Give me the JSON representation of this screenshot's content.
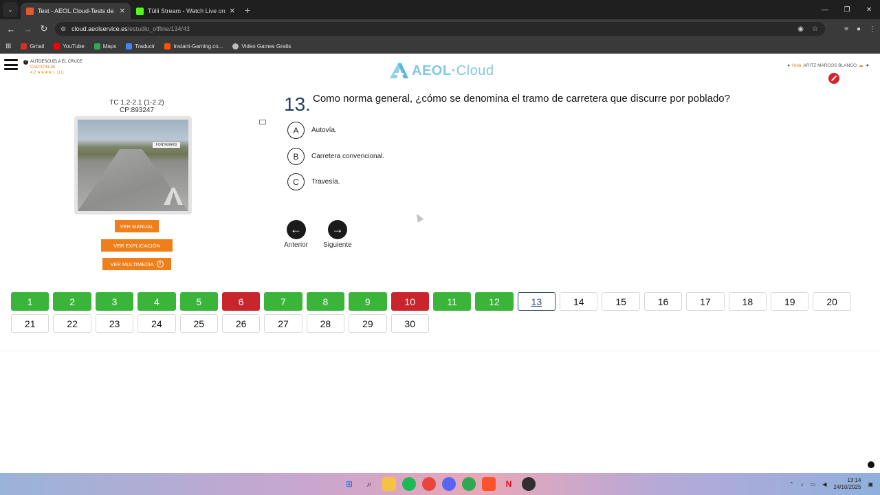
{
  "browser": {
    "tabs": [
      {
        "title": "Test - AEOL.Cloud-Tests de Aut",
        "favicon": "aeol-favicon",
        "active": true
      },
      {
        "title": "Tülli Stream - Watch Live on Kic",
        "favicon": "kick-favicon",
        "active": false
      }
    ],
    "url_host": "cloud.aeolservice.es",
    "url_path": "/estudio_offline/134/43",
    "bookmarks": [
      {
        "label": "Gmail",
        "icon": "gmail-icon",
        "color": "#d93025"
      },
      {
        "label": "YouTube",
        "icon": "youtube-icon",
        "color": "#ff0000"
      },
      {
        "label": "Maps",
        "icon": "maps-icon",
        "color": "#34a853"
      },
      {
        "label": "Traducir",
        "icon": "translate-icon",
        "color": "#4285f4"
      },
      {
        "label": "Instant-Gaming.co...",
        "icon": "instant-gaming-icon",
        "color": "#ff5400"
      },
      {
        "label": "Video Games Gratis",
        "icon": "globe-icon",
        "color": "#bbbbbb"
      }
    ]
  },
  "header": {
    "school_name": "AUTOESCUELA EL CRUCE",
    "school_code": "CAD:3741-35",
    "school_rating": "4.2 ★★★★☆ (11)",
    "logo_text": "AEOL",
    "logo_cloud": "Cloud",
    "greeting": "Hola",
    "user_name": "ARITZ MARCOS BLANCO",
    "brand_color": "#7fc8e6",
    "accent_color": "#ef7f1a"
  },
  "question": {
    "ref_line1": "TC 1.2-2.1 (1-2.2)",
    "ref_line2": "CP:893247",
    "photo_sign": "FONTANARS",
    "number": "13.",
    "text": "Como norma general, ¿cómo se denomina el tramo de carretera que discurre por poblado?",
    "answers": [
      {
        "letter": "A",
        "text": "Autovía."
      },
      {
        "letter": "B",
        "text": "Carretera convencional."
      },
      {
        "letter": "C",
        "text": "Travesía."
      }
    ],
    "buttons": {
      "manual": "VER MANUAL",
      "explanation": "VER EXPLICACIÓN",
      "multimedia": "VER MULTIMEDIA",
      "multimedia_count": "0"
    },
    "nav": {
      "prev": "Anterior",
      "next": "Siguiente"
    }
  },
  "grid": {
    "items": [
      {
        "n": "1",
        "state": "ok"
      },
      {
        "n": "2",
        "state": "ok"
      },
      {
        "n": "3",
        "state": "ok"
      },
      {
        "n": "4",
        "state": "ok"
      },
      {
        "n": "5",
        "state": "ok"
      },
      {
        "n": "6",
        "state": "fail"
      },
      {
        "n": "7",
        "state": "ok"
      },
      {
        "n": "8",
        "state": "ok"
      },
      {
        "n": "9",
        "state": "ok"
      },
      {
        "n": "10",
        "state": "fail"
      },
      {
        "n": "11",
        "state": "ok"
      },
      {
        "n": "12",
        "state": "ok"
      },
      {
        "n": "13",
        "state": "current"
      },
      {
        "n": "14",
        "state": "pending"
      },
      {
        "n": "15",
        "state": "pending"
      },
      {
        "n": "16",
        "state": "pending"
      },
      {
        "n": "17",
        "state": "pending"
      },
      {
        "n": "18",
        "state": "pending"
      },
      {
        "n": "19",
        "state": "pending"
      },
      {
        "n": "20",
        "state": "pending"
      },
      {
        "n": "21",
        "state": "pending"
      },
      {
        "n": "22",
        "state": "pending"
      },
      {
        "n": "23",
        "state": "pending"
      },
      {
        "n": "24",
        "state": "pending"
      },
      {
        "n": "25",
        "state": "pending"
      },
      {
        "n": "26",
        "state": "pending"
      },
      {
        "n": "27",
        "state": "pending"
      },
      {
        "n": "28",
        "state": "pending"
      },
      {
        "n": "29",
        "state": "pending"
      },
      {
        "n": "30",
        "state": "pending"
      }
    ],
    "colors": {
      "ok": "#3ab53a",
      "fail": "#c8262c",
      "current": "#2d4a6e"
    }
  },
  "taskbar": {
    "apps": [
      "windows-start-icon",
      "search-icon",
      "file-explorer-icon",
      "spotify-icon",
      "chrome-icon",
      "discord-icon",
      "app-icon",
      "brave-icon",
      "netflix-icon",
      "obs-icon"
    ],
    "time": "13:14",
    "date": "24/10/2025"
  }
}
